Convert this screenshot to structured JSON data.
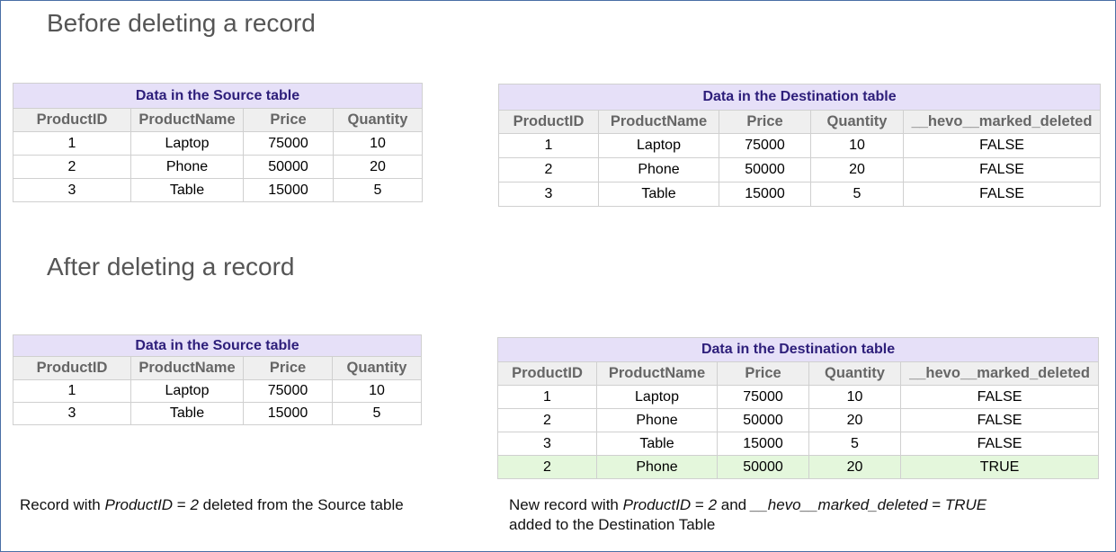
{
  "before": {
    "heading": "Before deleting a record",
    "source": {
      "title": "Data in the Source table",
      "columns": [
        "ProductID",
        "ProductName",
        "Price",
        "Quantity"
      ],
      "rows": [
        [
          "1",
          "Laptop",
          "75000",
          "10"
        ],
        [
          "2",
          "Phone",
          "50000",
          "20"
        ],
        [
          "3",
          "Table",
          "15000",
          "5"
        ]
      ]
    },
    "destination": {
      "title": "Data in the Destination table",
      "columns": [
        "ProductID",
        "ProductName",
        "Price",
        "Quantity",
        "__hevo__marked_deleted"
      ],
      "rows": [
        [
          "1",
          "Laptop",
          "75000",
          "10",
          "FALSE"
        ],
        [
          "2",
          "Phone",
          "50000",
          "20",
          "FALSE"
        ],
        [
          "3",
          "Table",
          "15000",
          "5",
          "FALSE"
        ]
      ]
    }
  },
  "after": {
    "heading": "After deleting a record",
    "source": {
      "title": "Data in the Source table",
      "columns": [
        "ProductID",
        "ProductName",
        "Price",
        "Quantity"
      ],
      "rows": [
        [
          "1",
          "Laptop",
          "75000",
          "10"
        ],
        [
          "3",
          "Table",
          "15000",
          "5"
        ]
      ]
    },
    "destination": {
      "title": "Data in the Destination table",
      "columns": [
        "ProductID",
        "ProductName",
        "Price",
        "Quantity",
        "__hevo__marked_deleted"
      ],
      "rows": [
        [
          "1",
          "Laptop",
          "75000",
          "10",
          "FALSE"
        ],
        [
          "2",
          "Phone",
          "50000",
          "20",
          "FALSE"
        ],
        [
          "3",
          "Table",
          "15000",
          "5",
          "FALSE"
        ],
        [
          "2",
          "Phone",
          "50000",
          "20",
          "TRUE"
        ]
      ],
      "highlight_color": "#e4f7dc"
    }
  },
  "captions": {
    "source": {
      "part1": "Record with ",
      "field": "ProductID",
      "part2": " = ",
      "value": "2",
      "part3": " deleted from the Source table"
    },
    "destination": {
      "part1": "New record with ",
      "field1": "ProductID",
      "part2": " = ",
      "value1": "2",
      "part3": " and ",
      "field2": "__hevo__marked_deleted",
      "part4": " = ",
      "value2": "TRUE",
      "line2": "added to the Destination Table"
    }
  }
}
